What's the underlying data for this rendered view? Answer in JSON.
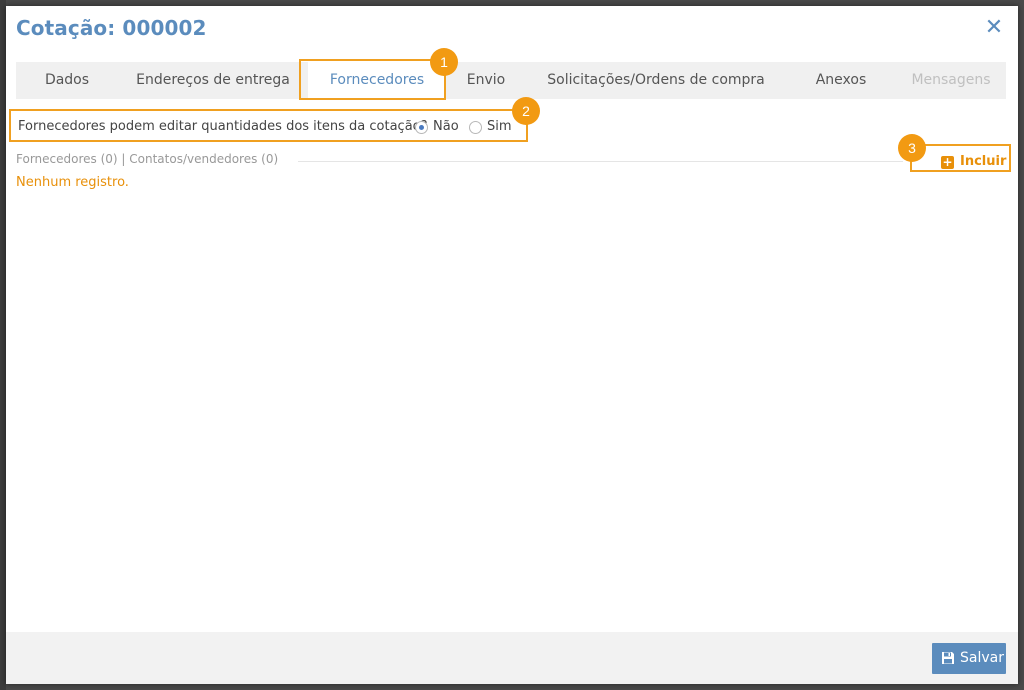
{
  "modal": {
    "title": "Cotação: 000002",
    "close_icon": "close-icon"
  },
  "tabs": [
    {
      "label": "Dados",
      "state": "normal"
    },
    {
      "label": "Endereços de entrega",
      "state": "normal"
    },
    {
      "label": "Fornecedores",
      "state": "active"
    },
    {
      "label": "Envio",
      "state": "normal"
    },
    {
      "label": "Solicitações/Ordens de compra",
      "state": "normal"
    },
    {
      "label": "Anexos",
      "state": "normal"
    },
    {
      "label": "Mensagens",
      "state": "disabled"
    }
  ],
  "question": {
    "text": "Fornecedores podem editar quantidades dos itens da cotação?",
    "options": [
      {
        "label": "Não",
        "selected": true
      },
      {
        "label": "Sim",
        "selected": false
      }
    ]
  },
  "section": {
    "heading": "Fornecedores (0) | Contatos/vendedores (0)",
    "empty_text": "Nenhum registro.",
    "include_label": "Incluir",
    "include_icon": "plus-square-icon"
  },
  "callouts": [
    "1",
    "2",
    "3"
  ],
  "footer": {
    "save_label": "Salvar",
    "save_icon": "floppy-disk-icon"
  },
  "colors": {
    "accent": "#5b8cbd",
    "callout": "#f29a12",
    "empty_text": "#e8900a"
  }
}
